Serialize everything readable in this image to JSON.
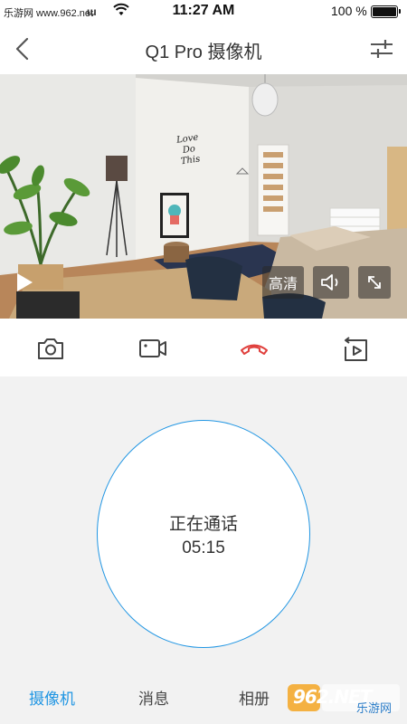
{
  "status_bar": {
    "carrier": "乐游网 www.962.net",
    "signal_glyph": "ɯ",
    "time": "11:27 AM",
    "battery": "100 %"
  },
  "nav": {
    "title": "Q1 Pro 摄像机",
    "back_icon": "chevron-left-icon",
    "settings_icon": "sliders-icon"
  },
  "video": {
    "hd_label": "高清",
    "poster_text_1": "Love",
    "poster_text_2": "Do",
    "poster_text_3": "This"
  },
  "toolbar": {
    "items": [
      "camera-icon",
      "record-video-icon",
      "hang-up-icon",
      "playback-icon"
    ],
    "hangup_color": "#e0403d"
  },
  "call": {
    "status": "正在通话",
    "timer": "05:15",
    "ring_color": "#2196e3"
  },
  "tabs": [
    {
      "label": "摄像机",
      "active": true
    },
    {
      "label": "消息",
      "active": false
    },
    {
      "label": "相册",
      "active": false
    }
  ],
  "watermark": {
    "brand": "962.NET",
    "sub": "乐游网"
  },
  "colors": {
    "accent": "#2196e3",
    "background": "#f2f2f2"
  }
}
